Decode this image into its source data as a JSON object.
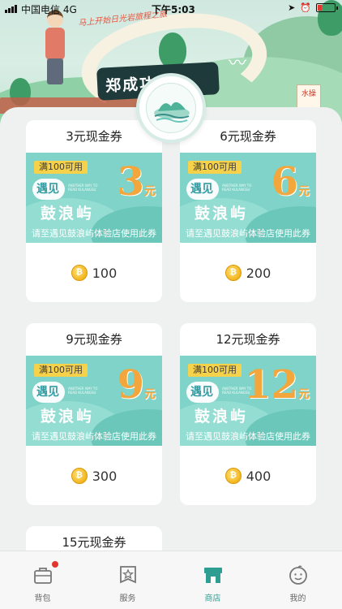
{
  "status_bar": {
    "carrier": "中国电信",
    "network": "4G",
    "time": "下午5:03"
  },
  "header": {
    "banner_text": "郑成功",
    "scribble_text": "马上开始日光岩旅程之旅",
    "sign_text": "水操"
  },
  "coupons": [
    {
      "title": "3元现金券",
      "badge": "满100可用",
      "amount": "3",
      "unit": "元",
      "brand_cloud": "遇见",
      "brand_en": "ANOTHER WAY TO READ KULANGSU",
      "brand_cn": "鼓浪屿",
      "note": "请至遇见鼓浪屿体验店使用此券",
      "price": "100"
    },
    {
      "title": "6元现金券",
      "badge": "满100可用",
      "amount": "6",
      "unit": "元",
      "brand_cloud": "遇见",
      "brand_en": "ANOTHER WAY TO READ KULANGSU",
      "brand_cn": "鼓浪屿",
      "note": "请至遇见鼓浪屿体验店使用此券",
      "price": "200"
    },
    {
      "title": "9元现金券",
      "badge": "满100可用",
      "amount": "9",
      "unit": "元",
      "brand_cloud": "遇见",
      "brand_en": "ANOTHER WAY TO READ KULANGSU",
      "brand_cn": "鼓浪屿",
      "note": "请至遇见鼓浪屿体验店使用此券",
      "price": "300"
    },
    {
      "title": "12元现金券",
      "badge": "满100可用",
      "amount": "12",
      "unit": "元",
      "brand_cloud": "遇见",
      "brand_en": "ANOTHER WAY TO READ KULANGSU",
      "brand_cn": "鼓浪屿",
      "note": "请至遇见鼓浪屿体验店使用此券",
      "price": "400"
    },
    {
      "title": "15元现金券"
    }
  ],
  "tabbar": {
    "items": [
      {
        "label": "背包",
        "icon": "backpack-icon",
        "badge_dot": true
      },
      {
        "label": "服务",
        "icon": "service-star-icon",
        "badge_dot": false
      },
      {
        "label": "商店",
        "icon": "store-icon",
        "badge_dot": false,
        "active": true
      },
      {
        "label": "我的",
        "icon": "profile-face-icon",
        "badge_dot": false
      }
    ]
  },
  "colors": {
    "accent": "#2e9e92",
    "coupon_bg": "#7fd3c8",
    "badge_bg": "#f6d24a",
    "amount_color": "#f2a63c",
    "notification_dot": "#e2352b"
  }
}
